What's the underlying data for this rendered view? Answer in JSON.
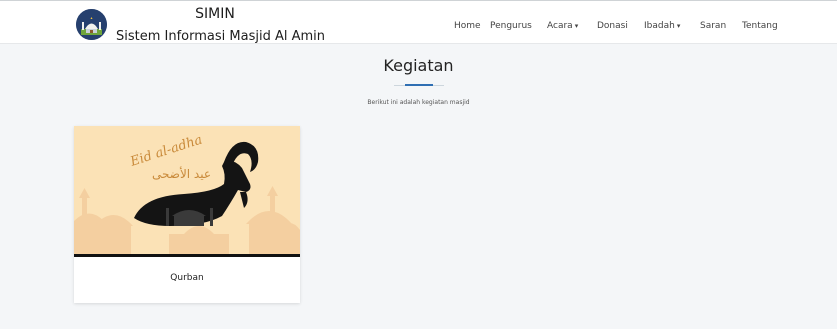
{
  "brand": {
    "title": "SIMIN",
    "subtitle": "Sistem Informasi Masjid Al Amin"
  },
  "nav": {
    "items": [
      {
        "label": "Home"
      },
      {
        "label": "Pengurus"
      },
      {
        "label": "Acara",
        "caret": "▾"
      },
      {
        "label": "Donasi"
      },
      {
        "label": "Ibadah",
        "caret": "▾"
      },
      {
        "label": "Saran"
      },
      {
        "label": "Tentang"
      }
    ]
  },
  "page": {
    "title": "Kegiatan",
    "intro": "Berikut ini adalah kegiatan masjid"
  },
  "cards": [
    {
      "title": "Qurban",
      "image_text_latin": "Eid al-adha",
      "image_text_arabic": "عيد الأضحى"
    }
  ],
  "colors": {
    "accent": "#2f6fb3",
    "card_image_bg": "#fbe2b6",
    "silhouette": "#f4cfa0",
    "text_orange": "#c98a3a"
  }
}
